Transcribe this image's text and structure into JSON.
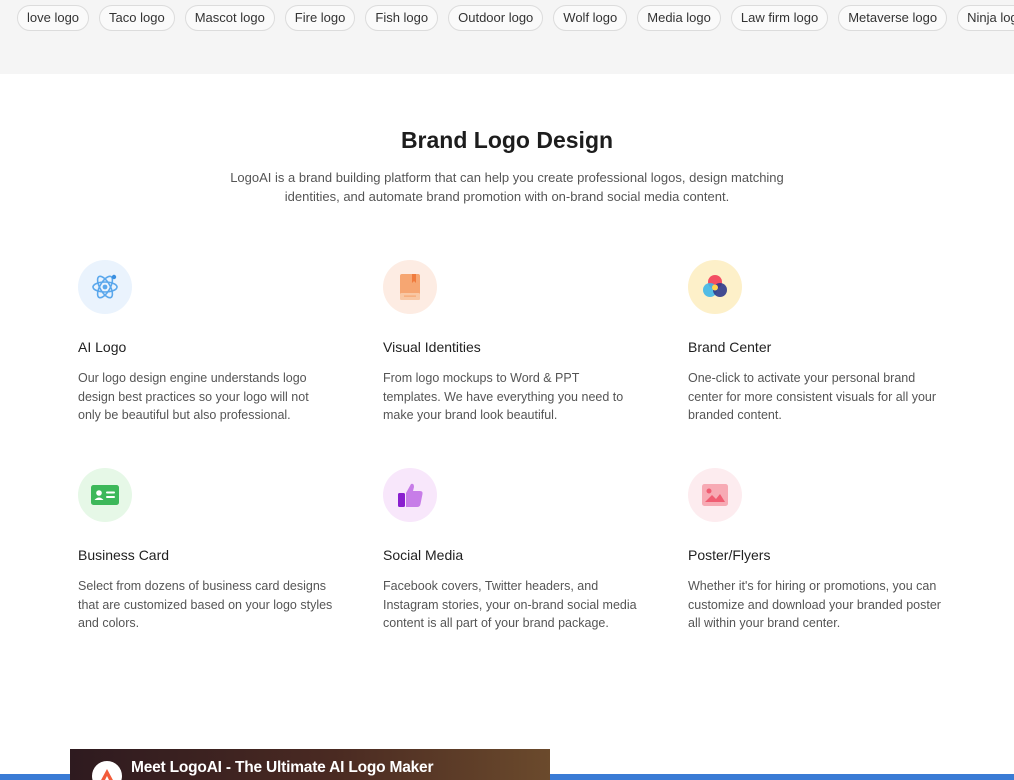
{
  "tags": [
    "love logo",
    "Taco logo",
    "Mascot logo",
    "Fire logo",
    "Fish logo",
    "Outdoor logo",
    "Wolf logo",
    "Media logo",
    "Law firm logo",
    "Metaverse logo",
    "Ninja logo",
    ""
  ],
  "section": {
    "title": "Brand Logo Design",
    "subtitle": "LogoAI is a brand building platform that can help you create professional logos, design matching identities, and automate brand promotion with on-brand social media content."
  },
  "features": [
    {
      "icon": "atom-icon",
      "icon_bg": "#eaf3fd",
      "title": "AI Logo",
      "desc": "Our logo design engine understands logo design best practices so your logo will not only be beautiful but also professional."
    },
    {
      "icon": "book-icon",
      "icon_bg": "#fdece3",
      "title": "Visual Identities",
      "desc": "From logo mockups to Word & PPT templates. We have everything you need to make your brand look beautiful."
    },
    {
      "icon": "color-circles-icon",
      "icon_bg": "#fdf0c9",
      "title": "Brand Center",
      "desc": "One-click to activate your personal brand center for more consistent visuals for all your branded content."
    },
    {
      "icon": "business-card-icon",
      "icon_bg": "#e6f8e7",
      "title": "Business Card",
      "desc": "Select from dozens of business card designs that are customized based on your logo styles and colors."
    },
    {
      "icon": "thumbs-up-icon",
      "icon_bg": "#f8e7fb",
      "title": "Social Media",
      "desc": "Facebook covers, Twitter headers, and Instagram stories, your on-brand social media content is all part of your brand package."
    },
    {
      "icon": "poster-icon",
      "icon_bg": "#fdecef",
      "title": "Poster/Flyers",
      "desc": "Whether it's for hiring or promotions, you can customize and download your branded poster all within your brand center."
    }
  ],
  "video": {
    "title": "Meet LogoAI - The Ultimate AI Logo Maker"
  },
  "colors": {
    "accent_bar": "#3a7bd5"
  }
}
